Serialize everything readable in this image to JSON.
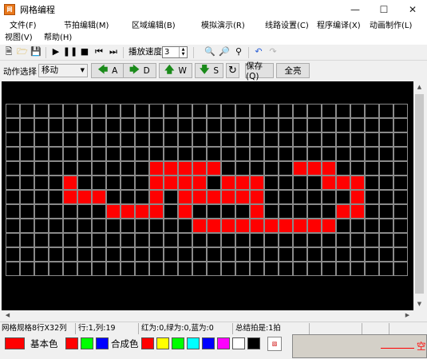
{
  "window": {
    "title": "网格编程",
    "app_icon_text": "网格"
  },
  "menu": [
    "文件(F)",
    "节拍编辑(M)",
    "区域编辑(B)",
    "模拟演示(R)",
    "线路设置(C)",
    "程序编译(X)",
    "动画制作(L)",
    "视图(V)",
    "帮助(H)"
  ],
  "toolbar": {
    "speed_label": "播放速度",
    "speed_value": "3"
  },
  "action_bar": {
    "label": "动作选择",
    "selected": "移动",
    "move_left": "A",
    "move_right": "D",
    "move_up": "W",
    "move_down": "S",
    "save": "保存(Q)",
    "select_all": "全亮"
  },
  "grid": {
    "rows": 12,
    "cols": 28,
    "on_cells": [
      [
        4,
        10
      ],
      [
        4,
        11
      ],
      [
        4,
        12
      ],
      [
        4,
        13
      ],
      [
        4,
        14
      ],
      [
        4,
        20
      ],
      [
        4,
        21
      ],
      [
        4,
        22
      ],
      [
        5,
        4
      ],
      [
        5,
        10
      ],
      [
        5,
        11
      ],
      [
        5,
        12
      ],
      [
        5,
        13
      ],
      [
        5,
        15
      ],
      [
        5,
        16
      ],
      [
        5,
        17
      ],
      [
        5,
        22
      ],
      [
        5,
        23
      ],
      [
        5,
        24
      ],
      [
        6,
        4
      ],
      [
        6,
        5
      ],
      [
        6,
        6
      ],
      [
        6,
        10
      ],
      [
        6,
        12
      ],
      [
        6,
        13
      ],
      [
        6,
        14
      ],
      [
        6,
        15
      ],
      [
        6,
        16
      ],
      [
        6,
        17
      ],
      [
        6,
        24
      ],
      [
        7,
        7
      ],
      [
        7,
        8
      ],
      [
        7,
        9
      ],
      [
        7,
        10
      ],
      [
        7,
        12
      ],
      [
        7,
        17
      ],
      [
        7,
        23
      ],
      [
        7,
        24
      ],
      [
        8,
        13
      ],
      [
        8,
        14
      ],
      [
        8,
        15
      ],
      [
        8,
        16
      ],
      [
        8,
        17
      ],
      [
        8,
        18
      ],
      [
        8,
        19
      ],
      [
        8,
        20
      ],
      [
        8,
        21
      ],
      [
        8,
        22
      ]
    ]
  },
  "status": {
    "grid_size": "网格规格8行X32列",
    "position": "行:1,列:19",
    "rgb": "红为:0,绿为:0,蓝为:0",
    "total": "总结拍是:1拍"
  },
  "colors": {
    "current": "#ff0000",
    "basic_label": "基本色",
    "basic": [
      "#ff0000",
      "#00ff00",
      "#0000ff"
    ],
    "mixed_label": "合成色",
    "mixed": [
      "#ff0000",
      "#ffff00",
      "#00ff00",
      "#00ffff",
      "#0000ff",
      "#ff00ff",
      "#ffffff",
      "#000000"
    ],
    "preview_text": "空"
  }
}
